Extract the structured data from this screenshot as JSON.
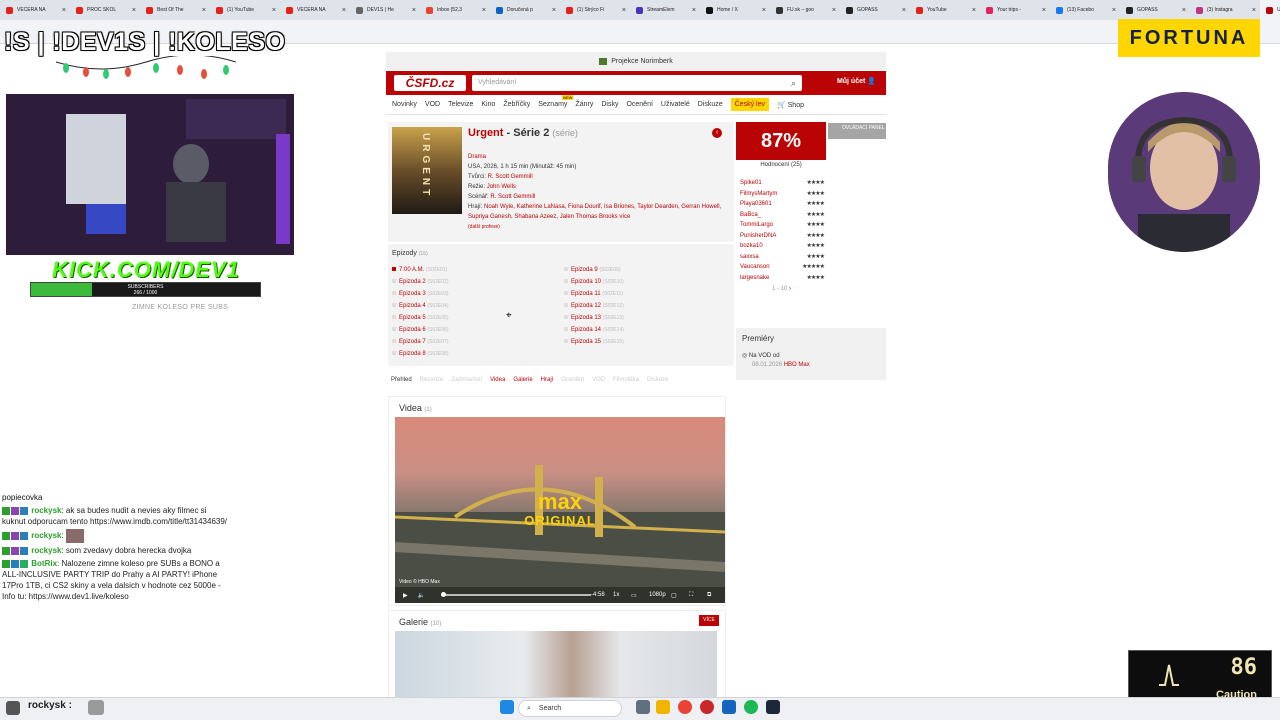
{
  "browser": {
    "tabs": [
      {
        "title": "VEČERA NA",
        "color": "#e62117"
      },
      {
        "title": "PROČ ŠKOL",
        "color": "#e62117"
      },
      {
        "title": "Best Of The",
        "color": "#e62117"
      },
      {
        "title": "(1) YouTube",
        "color": "#e62117"
      },
      {
        "title": "VEČERA NA",
        "color": "#e62117"
      },
      {
        "title": "DEV1S | He",
        "color": "#666666"
      },
      {
        "title": "Inbox (52,3",
        "color": "#ea4335"
      },
      {
        "title": "Doručená p",
        "color": "#0a66c2"
      },
      {
        "title": "(1) Strýco Fi",
        "color": "#e62117"
      },
      {
        "title": "StreamElem",
        "color": "#4b32c3"
      },
      {
        "title": "Home / X",
        "color": "#111111"
      },
      {
        "title": "FU.sk – goo",
        "color": "#333333"
      },
      {
        "title": "GOPASS",
        "color": "#222222"
      },
      {
        "title": "YouTube",
        "color": "#e62117"
      },
      {
        "title": "Your trips -",
        "color": "#e0245e"
      },
      {
        "title": "(13) Facebo",
        "color": "#1877f2"
      },
      {
        "title": "GOPASS",
        "color": "#222222"
      },
      {
        "title": "(3) Instagra",
        "color": "#c13584"
      },
      {
        "title": "Urge",
        "color": "#ba0305"
      }
    ]
  },
  "overlay": {
    "title": "!S | !DEV1S | !KOLESO",
    "kick": "KICK.COM/DEV1",
    "subscribers_label": "SUBSCRIBERS",
    "subscribers_count": "266 / 1000",
    "subscribers_fraction": 0.266,
    "subnote": "ZIMNE KOLESO PRE SUBS",
    "fortuna": "FORTUNA",
    "gauge_value": "86",
    "gauge_label": "Caution"
  },
  "chat": {
    "header": "popiecovka",
    "messages": [
      {
        "user": "rockysk",
        "text": ": ak sa budes nudit a nevies aky filmec si kuknut odporucam tento https://www.imdb.com/title/tt31434639/"
      },
      {
        "user": "rockysk",
        "text": ":"
      },
      {
        "user": "rockysk",
        "text": ": som zvedavy dobra herecka dvojka"
      },
      {
        "user": "BotRix",
        "text": ": Nalozene zimne koleso pre SUBs a BONO a ALL-INCLUSIVE PARTY TRIP do Prahy a AI PARTY! iPhone 17Pro 1TB, ci CS2 skiny a vela dalsich v hodnote cez 5000e - Info tu: https://www.dev1.live/koleso"
      }
    ]
  },
  "taskbar": {
    "user": "rockysk :",
    "search_label": "Search"
  },
  "site": {
    "promo": "Projekce Norimberk",
    "logo": "ČSFD.cz",
    "search_placeholder": "Vyhledávání",
    "account": "Můj účet",
    "nav": [
      "Novinky",
      "VOD",
      "Televize",
      "Kino",
      "Žebříčky",
      "Seznamy",
      "Žánry",
      "Disky",
      "Ocenění",
      "Uživatelé",
      "Diskuze"
    ],
    "nav_special": "Český lev",
    "nav_shop": "Shop",
    "film": {
      "title": "Urgent",
      "season": " - Série 2",
      "type": "(série)",
      "genre": "Drama",
      "origin": "USA, 2026, 1 h 15 min (Minutáž: 45 min)",
      "creators_label": "Tvůrci:",
      "creators": "R. Scott Gemmill",
      "director_label": "Režie:",
      "director": "John Wells",
      "writer_label": "Scénář:",
      "writer": "R. Scott Gemmill",
      "cast_label": "Hrají:",
      "cast": "Noah Wyle, Katherine LaNasa, Fiona Dourif, Isa Briones, Taylor Dearden, Gerran Howell, Supriya Ganesh, Shabana Azeez, Jalen Thomas Brooks",
      "cast_more": "více",
      "more_professions": "(další profese)",
      "poster_text": "URGENT"
    },
    "rating": "87%",
    "panel_button": "OVLÁDACÍ PANEL",
    "ratings_header": "Hodnocení",
    "ratings_count": "(25)",
    "raters": [
      {
        "name": "Spike01",
        "stars": "★★★★"
      },
      {
        "name": "FilmysMartym",
        "stars": "★★★★"
      },
      {
        "name": "Playa03601",
        "stars": "★★★★"
      },
      {
        "name": "BaBca_",
        "stars": "★★★★"
      },
      {
        "name": "TommiLargo",
        "stars": "★★★★"
      },
      {
        "name": "PunisherDNA",
        "stars": "★★★★"
      },
      {
        "name": "bozka10",
        "stars": "★★★★"
      },
      {
        "name": "saxxsa",
        "stars": "★★★★"
      },
      {
        "name": "Vaucanson",
        "stars": "★★★★★"
      },
      {
        "name": "largesnake",
        "stars": "★★★★"
      }
    ],
    "ratings_pager": "1 - 10",
    "premiery": {
      "title": "Premiéry",
      "vod_label": "Na VOD od",
      "date": "08.01.2026",
      "service": "HBO Max"
    },
    "episodes": {
      "title": "Epizody",
      "count": "(15)",
      "col1": [
        {
          "name": "7:00 A.M.",
          "code": "(S02E01)"
        },
        {
          "name": "Epizoda 2",
          "code": "(S02E02)"
        },
        {
          "name": "Epizoda 3",
          "code": "(S02E03)"
        },
        {
          "name": "Epizoda 4",
          "code": "(S02E04)"
        },
        {
          "name": "Epizoda 5",
          "code": "(S02E05)"
        },
        {
          "name": "Epizoda 6",
          "code": "(S02E06)"
        },
        {
          "name": "Epizoda 7",
          "code": "(S02E07)"
        },
        {
          "name": "Epizoda 8",
          "code": "(S02E08)"
        }
      ],
      "col2": [
        {
          "name": "Epizoda 9",
          "code": "(S02E09)"
        },
        {
          "name": "Epizoda 10",
          "code": "(S02E10)"
        },
        {
          "name": "Epizoda 11",
          "code": "(S02E11)"
        },
        {
          "name": "Epizoda 12",
          "code": "(S02E12)"
        },
        {
          "name": "Epizoda 13",
          "code": "(S02E13)"
        },
        {
          "name": "Epizoda 14",
          "code": "(S02E14)"
        },
        {
          "name": "Epizoda 15",
          "code": "(S02E15)"
        }
      ]
    },
    "tabs": [
      {
        "label": "Přehled",
        "state": "on"
      },
      {
        "label": "Recenze",
        "state": "dim"
      },
      {
        "label": "Zajímavosti",
        "state": "dim"
      },
      {
        "label": "Videa",
        "state": "act"
      },
      {
        "label": "Galerie",
        "state": "act"
      },
      {
        "label": "Hrají",
        "state": "act"
      },
      {
        "label": "Ocenění",
        "state": "dim"
      },
      {
        "label": "VOD",
        "state": "dim"
      },
      {
        "label": "Filmotéka",
        "state": "dim"
      },
      {
        "label": "Diskuze",
        "state": "dim"
      }
    ],
    "videa": {
      "title": "Videa",
      "count": "(1)",
      "brand": "max",
      "brand_sub": "ORIGINAL",
      "credit": "Video © HBO Max",
      "time": "-4:58",
      "quality": "1080p"
    },
    "galerie": {
      "title": "Galerie",
      "count": "(10)",
      "more": "VÍCE"
    }
  },
  "colors": {
    "csfd_red": "#ba0305",
    "highlight_yellow": "#ffd600",
    "kick_green": "#53fc18"
  }
}
